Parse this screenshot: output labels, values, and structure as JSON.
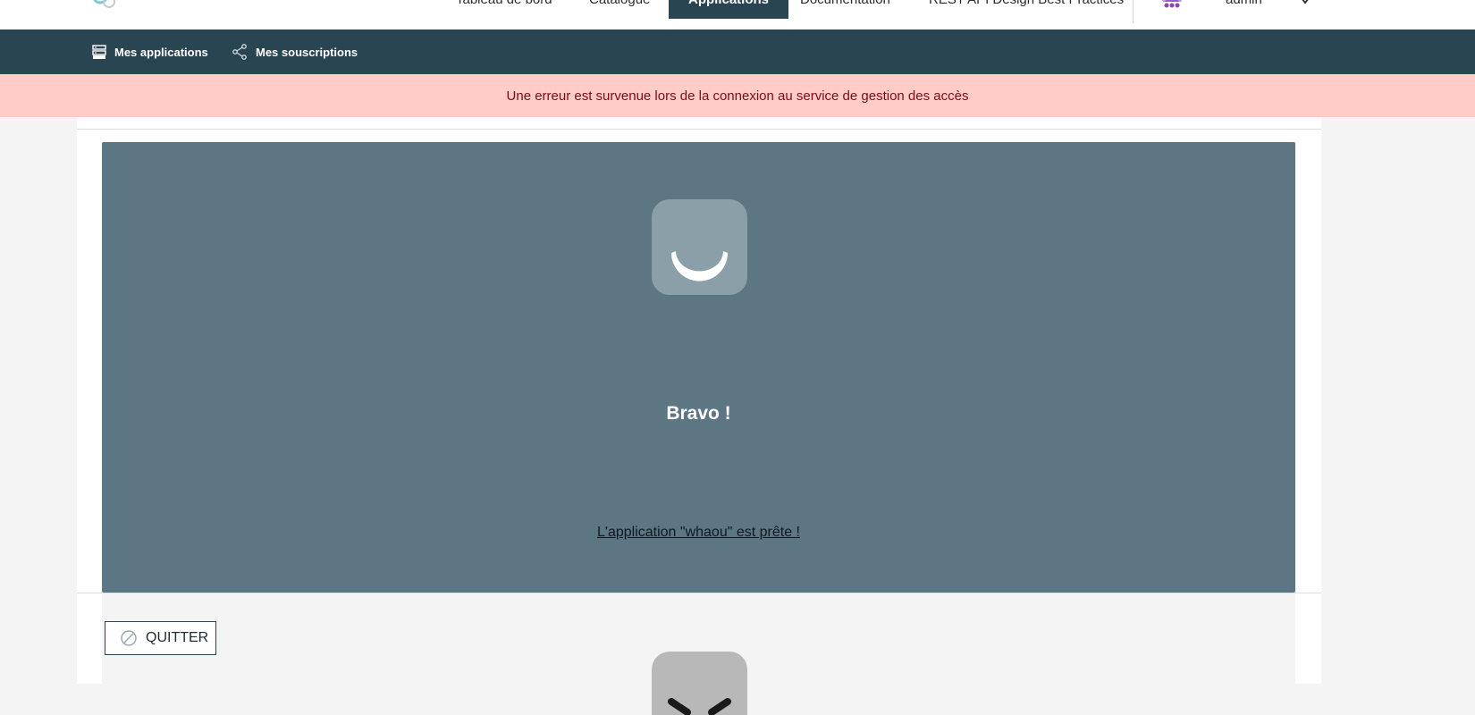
{
  "topnav": {
    "items": [
      {
        "label": "Tableau de bord"
      },
      {
        "label": "Catalogue"
      },
      {
        "label": "Applications",
        "active": true
      },
      {
        "label": "Documentation"
      },
      {
        "label": "REST API Design Best Practices"
      }
    ],
    "user": {
      "name": "admin"
    }
  },
  "subnav": {
    "items": [
      {
        "label": "Mes applications",
        "icon": "apps-icon"
      },
      {
        "label": "Mes souscriptions",
        "icon": "share-icon"
      }
    ]
  },
  "banner": {
    "message": "Une erreur est survenue lors de la connexion au service de gestion des accès"
  },
  "hero": {
    "icon": "smile-icon",
    "title": "Bravo !",
    "link_text": "L'application \"whaou\" est prête !"
  },
  "actions": {
    "quit_label": "QUITTER",
    "quit_icon": "cancel-icon"
  },
  "colors": {
    "nav_dark": "#2a4552",
    "banner_bg": "#ffccc7",
    "banner_text": "#7a0c18",
    "hero_bg": "#5c7684"
  }
}
